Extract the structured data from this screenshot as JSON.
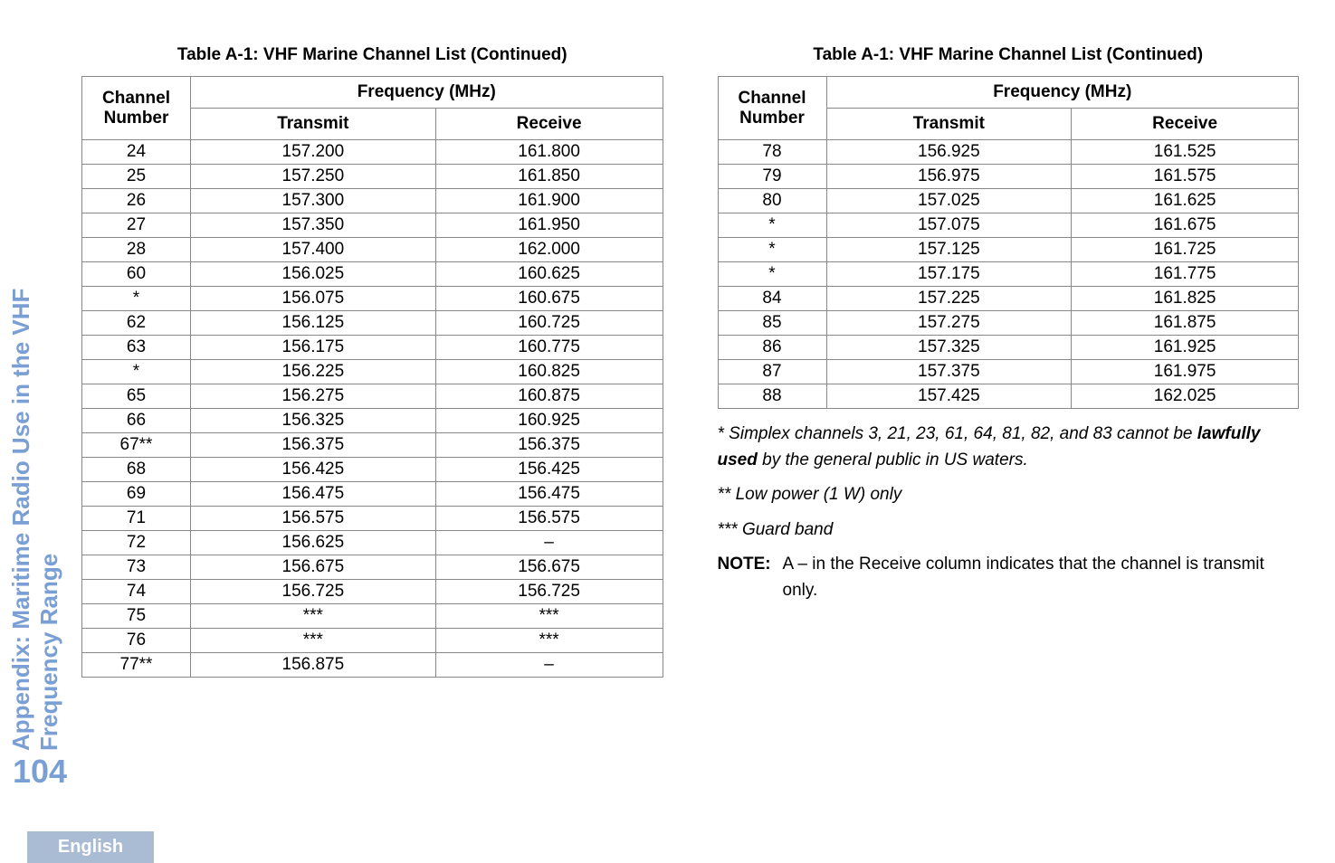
{
  "sidebar": {
    "title_line1": "Appendix: Maritime Radio Use in the VHF",
    "title_line2": "Frequency Range",
    "page_number": "104",
    "language": "English"
  },
  "table_caption": "Table A-1: VHF Marine Channel List (Continued)",
  "headers": {
    "channel": "Channel Number",
    "frequency": "Frequency (MHz)",
    "transmit": "Transmit",
    "receive": "Receive"
  },
  "table1_rows": [
    {
      "ch": "24",
      "tx": "157.200",
      "rx": "161.800"
    },
    {
      "ch": "25",
      "tx": "157.250",
      "rx": "161.850"
    },
    {
      "ch": "26",
      "tx": "157.300",
      "rx": "161.900"
    },
    {
      "ch": "27",
      "tx": "157.350",
      "rx": "161.950"
    },
    {
      "ch": "28",
      "tx": "157.400",
      "rx": "162.000"
    },
    {
      "ch": "60",
      "tx": "156.025",
      "rx": "160.625"
    },
    {
      "ch": "*",
      "tx": "156.075",
      "rx": "160.675"
    },
    {
      "ch": "62",
      "tx": "156.125",
      "rx": "160.725"
    },
    {
      "ch": "63",
      "tx": "156.175",
      "rx": "160.775"
    },
    {
      "ch": "*",
      "tx": "156.225",
      "rx": "160.825"
    },
    {
      "ch": "65",
      "tx": "156.275",
      "rx": "160.875"
    },
    {
      "ch": "66",
      "tx": "156.325",
      "rx": "160.925"
    },
    {
      "ch": "67**",
      "tx": "156.375",
      "rx": "156.375"
    },
    {
      "ch": "68",
      "tx": "156.425",
      "rx": "156.425"
    },
    {
      "ch": "69",
      "tx": "156.475",
      "rx": "156.475"
    },
    {
      "ch": "71",
      "tx": "156.575",
      "rx": "156.575"
    },
    {
      "ch": "72",
      "tx": "156.625",
      "rx": "–"
    },
    {
      "ch": "73",
      "tx": "156.675",
      "rx": "156.675"
    },
    {
      "ch": "74",
      "tx": "156.725",
      "rx": "156.725"
    },
    {
      "ch": "75",
      "tx": "***",
      "rx": "***"
    },
    {
      "ch": "76",
      "tx": "***",
      "rx": "***"
    },
    {
      "ch": "77**",
      "tx": "156.875",
      "rx": "–"
    }
  ],
  "table2_rows": [
    {
      "ch": "78",
      "tx": "156.925",
      "rx": "161.525"
    },
    {
      "ch": "79",
      "tx": "156.975",
      "rx": "161.575"
    },
    {
      "ch": "80",
      "tx": "157.025",
      "rx": "161.625"
    },
    {
      "ch": "*",
      "tx": "157.075",
      "rx": "161.675"
    },
    {
      "ch": "*",
      "tx": "157.125",
      "rx": "161.725"
    },
    {
      "ch": "*",
      "tx": "157.175",
      "rx": "161.775"
    },
    {
      "ch": "84",
      "tx": "157.225",
      "rx": "161.825"
    },
    {
      "ch": "85",
      "tx": "157.275",
      "rx": "161.875"
    },
    {
      "ch": "86",
      "tx": "157.325",
      "rx": "161.925"
    },
    {
      "ch": "87",
      "tx": "157.375",
      "rx": "161.975"
    },
    {
      "ch": "88",
      "tx": "157.425",
      "rx": "162.025"
    }
  ],
  "footnotes": {
    "f1_a": "* Simplex channels 3, 21, 23, 61, 64, 81, 82, and 83 cannot be ",
    "f1_b": "lawfully used",
    "f1_c": " by the general public in US waters.",
    "f2": "** Low power (1 W) only",
    "f3": "*** Guard band",
    "note_label": "NOTE:",
    "note_body": "A – in the Receive column indicates that the channel is transmit only."
  }
}
